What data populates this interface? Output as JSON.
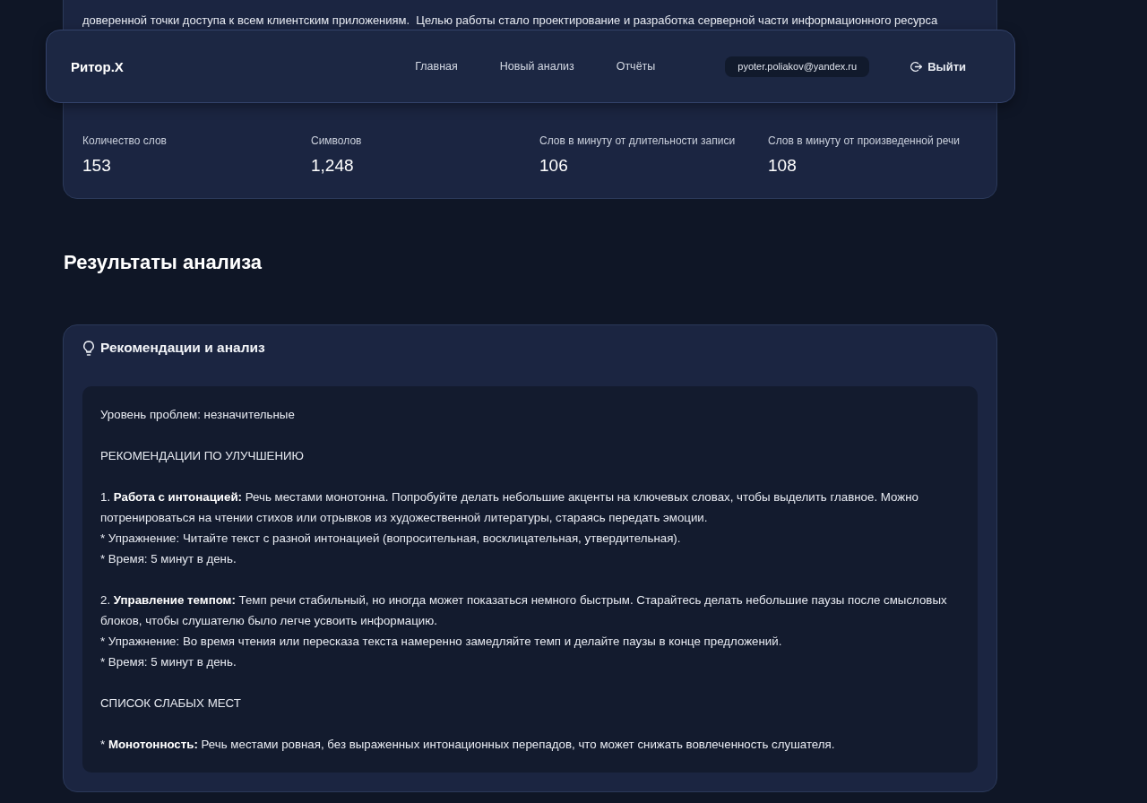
{
  "background_text": "доверенной точки доступа к всем клиентским приложениям.  Целью работы стало проектирование и разработка серверной части информационного ресурса",
  "header": {
    "logo": "Ритор.X",
    "nav": [
      "Главная",
      "Новый анализ",
      "Отчёты"
    ],
    "email": "pyoter.poliakov@yandex.ru",
    "logout": "Выйти"
  },
  "stats": [
    {
      "label": "Количество слов",
      "value": "153"
    },
    {
      "label": "Символов",
      "value": "1,248"
    },
    {
      "label": "Слов в минуту от длительности записи",
      "value": "106"
    },
    {
      "label": "Слов в минуту от произведенной речи",
      "value": "108"
    }
  ],
  "results_title": "Результаты анализа",
  "recommendations": {
    "title": "Рекомендации и анализ",
    "blocks": [
      [
        "Уровень проблем: незначительные"
      ],
      [
        "РЕКОМЕНДАЦИИ ПО УЛУЧШЕНИЮ"
      ],
      [
        "1. **Работа с интонацией:** Речь местами монотонна. Попробуйте делать небольшие акценты на ключевых словах, чтобы выделить главное. Можно потренироваться на чтении стихов или отрывков из художественной литературы, стараясь передать эмоции.",
        "* Упражнение: Читайте текст с разной интонацией (вопросительная, восклицательная, утвердительная).",
        "* Время: 5 минут в день."
      ],
      [
        "2. **Управление темпом:** Темп речи стабильный, но иногда может показаться немного быстрым. Старайтесь делать небольшие паузы после смысловых блоков, чтобы слушателю было легче усвоить информацию.",
        "* Упражнение: Во время чтения или пересказа текста намеренно замедляйте темп и делайте паузы в конце предложений.",
        "* Время: 5 минут в день."
      ],
      [
        "СПИСОК СЛАБЫХ МЕСТ"
      ],
      [
        "* **Монотонность:** Речь местами ровная, без выраженных интонационных перепадов, что может снижать вовлеченность слушателя."
      ]
    ]
  }
}
